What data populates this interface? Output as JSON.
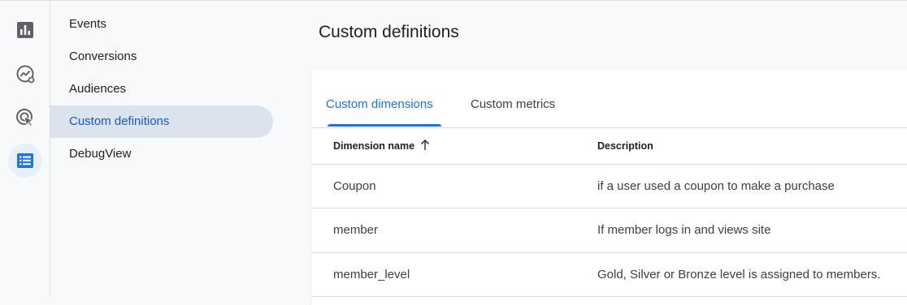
{
  "rail": {
    "items": [
      {
        "icon": "reports-bar-chart-icon"
      },
      {
        "icon": "explore-icon"
      },
      {
        "icon": "advertising-icon"
      },
      {
        "icon": "configure-list-icon",
        "active": true
      }
    ]
  },
  "nav": {
    "items": [
      {
        "label": "Events"
      },
      {
        "label": "Conversions"
      },
      {
        "label": "Audiences"
      },
      {
        "label": "Custom definitions",
        "active": true
      },
      {
        "label": "DebugView"
      }
    ]
  },
  "main": {
    "title": "Custom definitions",
    "tabs": [
      {
        "label": "Custom dimensions",
        "active": true
      },
      {
        "label": "Custom metrics"
      }
    ],
    "table": {
      "columns": [
        "Dimension name",
        "Description"
      ],
      "sort_icon": "arrow-up-icon",
      "rows": [
        {
          "name": "Coupon",
          "description": "if a user used a coupon to make a purchase"
        },
        {
          "name": "member",
          "description": "If member logs in and views site"
        },
        {
          "name": "member_level",
          "description": "Gold, Silver or Bronze level is assigned to members."
        }
      ]
    }
  },
  "colors": {
    "accent": "#1a73e8",
    "active_nav_bg": "#dbe3ef",
    "active_rail_bg": "#e8f0fe",
    "icon_gray": "#5f6368"
  }
}
